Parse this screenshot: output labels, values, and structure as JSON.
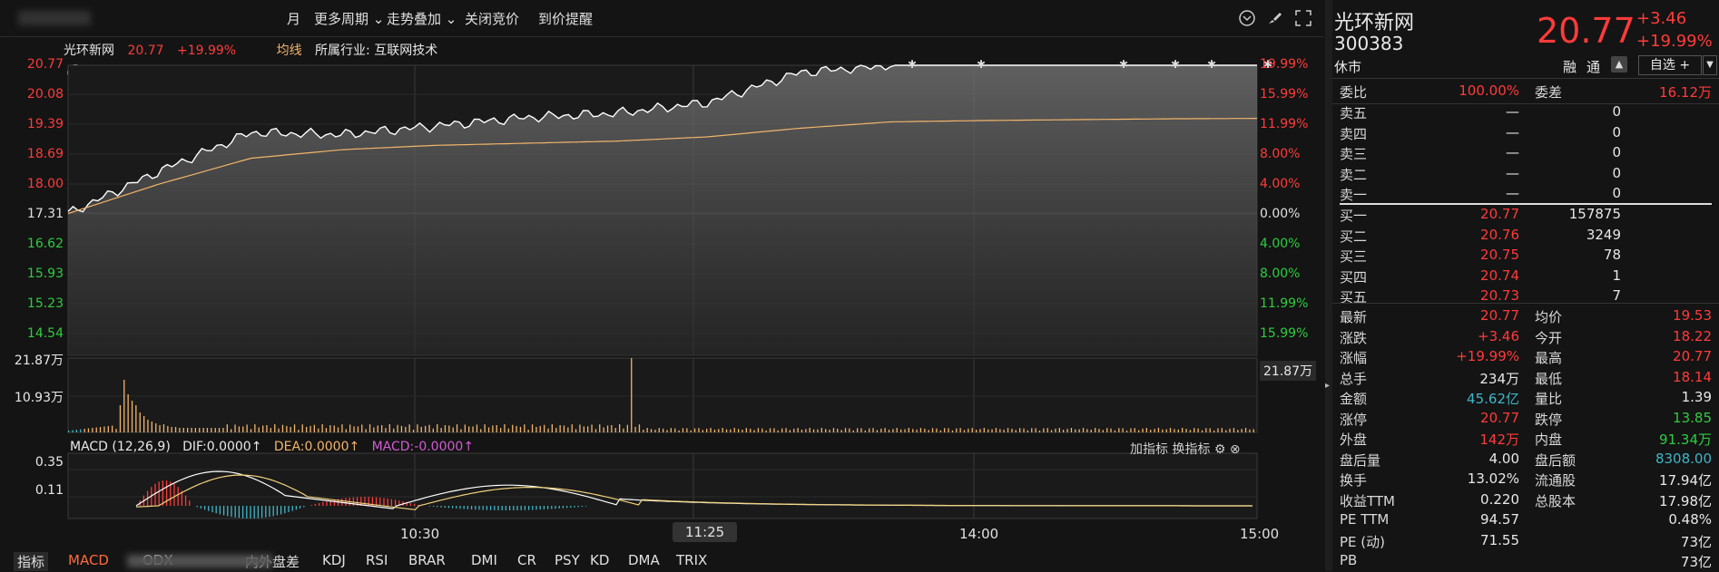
{
  "toolbar": {
    "month": "月",
    "more_periods": "更多周期",
    "trend_overlay": "走势叠加",
    "close_auction": "关闭竞价",
    "price_alert": "到价提醒"
  },
  "info": {
    "name": "光环新网",
    "price": "20.77",
    "change_pct": "+19.99%",
    "avg_line": "均线",
    "industry": "所属行业: 互联网技术"
  },
  "axes": {
    "price_labels": [
      "20.77",
      "20.08",
      "19.39",
      "18.69",
      "18.00",
      "17.31",
      "16.62",
      "15.93",
      "15.23",
      "14.54"
    ],
    "pct_labels": [
      "19.99%",
      "15.99%",
      "11.99%",
      "8.00%",
      "4.00%",
      "0.00%",
      "4.00%",
      "8.00%",
      "11.99%",
      "15.99%"
    ],
    "vol_left": [
      "21.87万",
      "10.93万"
    ],
    "vol_right": "21.87万",
    "macd_left": [
      "0.35",
      "0.11"
    ],
    "times": [
      "10:30",
      "11:25",
      "14:00",
      "15:00"
    ]
  },
  "chart_data": {
    "type": "line",
    "x": [
      "09:30",
      "09:45",
      "10:00",
      "10:15",
      "10:30",
      "10:45",
      "11:00",
      "11:15",
      "11:30",
      "13:15",
      "13:30",
      "14:00",
      "14:30",
      "15:00"
    ],
    "series": [
      {
        "values": [
          17.31,
          18.3,
          19.2,
          19.15,
          19.35,
          19.55,
          19.65,
          19.9,
          20.6,
          20.77,
          20.77,
          20.77,
          20.77,
          20.77
        ]
      },
      {
        "values": [
          17.31,
          18.0,
          18.6,
          18.8,
          18.9,
          18.95,
          19.0,
          19.1,
          19.3,
          19.45,
          19.48,
          19.5,
          19.52,
          19.53
        ]
      }
    ],
    "ylim": [
      14.0,
      20.77
    ]
  },
  "macd": {
    "label": "MACD (12,26,9)",
    "dif": "DIF:0.0000",
    "dea": "DEA:0.0000",
    "macd": "MACD:-0.0000",
    "add_indicator": "加指标",
    "switch_indicator": "换指标"
  },
  "bottom_tabs": [
    "指标",
    "MACD",
    "ODX",
    "内外盘差",
    "KDJ",
    "RSI",
    "BRAR",
    "DMI",
    "CR",
    "PSY",
    "KD",
    "DMA",
    "TRIX"
  ],
  "panel": {
    "name": "光环新网",
    "code": "300383",
    "status": "休市",
    "price": "20.77",
    "change": "+3.46",
    "change_pct": "+19.99%",
    "margin": "融",
    "tong": "通",
    "self_select": "自选 +",
    "weibi_label": "委比",
    "weibi": "100.00%",
    "weicha_label": "委差",
    "weicha": "16.12万",
    "asks": [
      {
        "label": "卖五",
        "price": "—",
        "vol": "0"
      },
      {
        "label": "卖四",
        "price": "—",
        "vol": "0"
      },
      {
        "label": "卖三",
        "price": "—",
        "vol": "0"
      },
      {
        "label": "卖二",
        "price": "—",
        "vol": "0"
      },
      {
        "label": "卖一",
        "price": "—",
        "vol": "0"
      }
    ],
    "bids": [
      {
        "label": "买一",
        "price": "20.77",
        "vol": "157875"
      },
      {
        "label": "买二",
        "price": "20.76",
        "vol": "3249"
      },
      {
        "label": "买三",
        "price": "20.75",
        "vol": "78"
      },
      {
        "label": "买四",
        "price": "20.74",
        "vol": "1"
      },
      {
        "label": "买五",
        "price": "20.73",
        "vol": "7"
      }
    ],
    "stats": [
      {
        "l1": "最新",
        "v1": "20.77",
        "c1": "red",
        "l2": "均价",
        "v2": "19.53",
        "c2": "red"
      },
      {
        "l1": "涨跌",
        "v1": "+3.46",
        "c1": "red",
        "l2": "今开",
        "v2": "18.22",
        "c2": "red"
      },
      {
        "l1": "涨幅",
        "v1": "+19.99%",
        "c1": "red",
        "l2": "最高",
        "v2": "20.77",
        "c2": "red"
      },
      {
        "l1": "总手",
        "v1": "234万",
        "c1": "white",
        "l2": "最低",
        "v2": "18.14",
        "c2": "red"
      },
      {
        "l1": "金额",
        "v1": "45.62亿",
        "c1": "cyan",
        "l2": "量比",
        "v2": "1.39",
        "c2": "white"
      },
      {
        "l1": "涨停",
        "v1": "20.77",
        "c1": "red",
        "l2": "跌停",
        "v2": "13.85",
        "c2": "green"
      },
      {
        "l1": "外盘",
        "v1": "142万",
        "c1": "red",
        "l2": "内盘",
        "v2": "91.34万",
        "c2": "green"
      },
      {
        "l1": "盘后量",
        "v1": "4.00",
        "c1": "white",
        "l2": "盘后额",
        "v2": "8308.00",
        "c2": "cyan"
      },
      {
        "l1": "换手",
        "v1": "13.02%",
        "c1": "white",
        "l2": "流通股",
        "v2": "17.94亿",
        "c2": "white"
      },
      {
        "l1": "收益TTM",
        "v1": "0.220",
        "c1": "white",
        "l2": "总股本",
        "v2": "17.98亿",
        "c2": "white"
      },
      {
        "l1": "PE TTM",
        "v1": "94.57",
        "c1": "white",
        "l2": "",
        "v2": "0.48%",
        "c2": "white"
      },
      {
        "l1": "PE (动)",
        "v1": "71.55",
        "c1": "white",
        "l2": "",
        "v2": "73亿",
        "c2": "white"
      },
      {
        "l1": "PB",
        "v1": "",
        "c1": "white",
        "l2": "",
        "v2": "73亿",
        "c2": "white"
      }
    ]
  },
  "colors": {
    "up": "#ff3b3b",
    "down": "#2ecc40",
    "line": "#ffffff",
    "avg": "#f2b46b"
  }
}
